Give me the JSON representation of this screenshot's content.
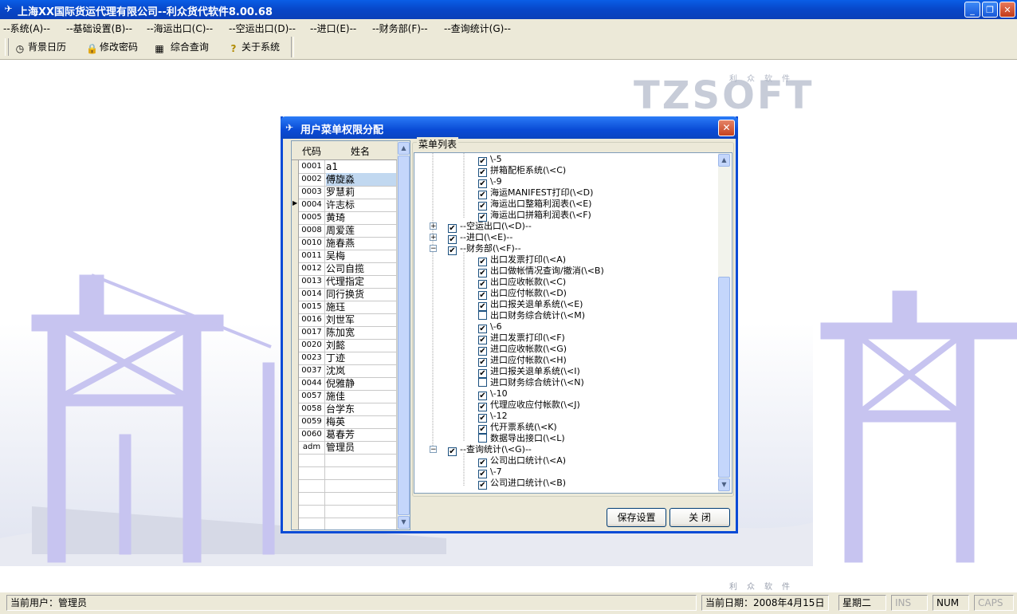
{
  "window": {
    "title": "上海XX国际货运代理有限公司--利众货代软件8.00.68",
    "minimize_glyph": "_",
    "restore_glyph": "❐",
    "close_glyph": "✕"
  },
  "menu": [
    "--系统(A)--",
    "--基础设置(B)--",
    "--海运出口(C)--",
    "--空运出口(D)--",
    "--进口(E)--",
    "--财务部(F)--",
    "--查询统计(G)--"
  ],
  "toolbar": [
    {
      "label": "背景日历",
      "icon": "calendar-clock-icon",
      "glyph": "◷"
    },
    {
      "label": "修改密码",
      "icon": "lock-icon",
      "glyph": "🔒"
    },
    {
      "label": "综合查询",
      "icon": "grid-icon",
      "glyph": "▦"
    },
    {
      "label": "关于系统",
      "icon": "help-icon",
      "glyph": "?"
    }
  ],
  "background": {
    "logo_text": "TZSOFT",
    "logo_sub": "利众软件",
    "bottom_sub": "利众软件"
  },
  "dialog": {
    "title": "用户菜单权限分配",
    "close_glyph": "✕",
    "group_label": "菜单列表",
    "grid_headers": {
      "code": "代码",
      "name": "姓名"
    },
    "users": [
      {
        "code": "0001",
        "name": "a1"
      },
      {
        "code": "0002",
        "name": "傅旋淼"
      },
      {
        "code": "0003",
        "name": "罗慧莉"
      },
      {
        "code": "0004",
        "name": "许志标"
      },
      {
        "code": "0005",
        "name": "黄琦"
      },
      {
        "code": "0008",
        "name": "周爱莲"
      },
      {
        "code": "0010",
        "name": "施春燕"
      },
      {
        "code": "0011",
        "name": "吴梅"
      },
      {
        "code": "0012",
        "name": "公司自揽"
      },
      {
        "code": "0013",
        "name": "代理指定"
      },
      {
        "code": "0014",
        "name": "同行换货"
      },
      {
        "code": "0015",
        "name": "施珏"
      },
      {
        "code": "0016",
        "name": "刘世军"
      },
      {
        "code": "0017",
        "name": "陈加宽"
      },
      {
        "code": "0020",
        "name": "刘懿"
      },
      {
        "code": "0023",
        "name": "丁迹"
      },
      {
        "code": "0037",
        "name": "沈岚"
      },
      {
        "code": "0044",
        "name": "倪雅静"
      },
      {
        "code": "0057",
        "name": "施佳"
      },
      {
        "code": "0058",
        "name": "台学东"
      },
      {
        "code": "0059",
        "name": "梅英"
      },
      {
        "code": "0060",
        "name": "葛春芳"
      },
      {
        "code": "adm",
        "name": "管理员"
      }
    ],
    "selected_user_index": 1,
    "tree": [
      {
        "label": "\\-5",
        "checked": true,
        "level": 2
      },
      {
        "label": "拼箱配柜系统(\\<C)",
        "checked": true,
        "level": 2
      },
      {
        "label": "\\-9",
        "checked": true,
        "level": 2
      },
      {
        "label": "海运MANIFEST打印(\\<D)",
        "checked": true,
        "level": 2
      },
      {
        "label": "海运出口整箱利润表(\\<E)",
        "checked": true,
        "level": 2
      },
      {
        "label": "海运出口拼箱利润表(\\<F)",
        "checked": true,
        "level": 2
      },
      {
        "label": "--空运出口(\\<D)--",
        "checked": true,
        "level": 1,
        "expander": "+"
      },
      {
        "label": "--进口(\\<E)--",
        "checked": true,
        "level": 1,
        "expander": "+"
      },
      {
        "label": "--财务部(\\<F)--",
        "checked": true,
        "level": 1,
        "expander": "-"
      },
      {
        "label": "出口发票打印(\\<A)",
        "checked": true,
        "level": 2
      },
      {
        "label": "出口做帐情况查询/撤消(\\<B)",
        "checked": true,
        "level": 2
      },
      {
        "label": "出口应收帐款(\\<C)",
        "checked": true,
        "level": 2
      },
      {
        "label": "出口应付帐款(\\<D)",
        "checked": true,
        "level": 2
      },
      {
        "label": "出口报关退单系统(\\<E)",
        "checked": true,
        "level": 2
      },
      {
        "label": "出口财务综合统计(\\<M)",
        "checked": false,
        "level": 2
      },
      {
        "label": "\\-6",
        "checked": true,
        "level": 2
      },
      {
        "label": "进口发票打印(\\<F)",
        "checked": true,
        "level": 2
      },
      {
        "label": "进口应收帐款(\\<G)",
        "checked": true,
        "level": 2
      },
      {
        "label": "进口应付帐款(\\<H)",
        "checked": true,
        "level": 2
      },
      {
        "label": "进口报关退单系统(\\<I)",
        "checked": true,
        "level": 2
      },
      {
        "label": "进口财务综合统计(\\<N)",
        "checked": false,
        "level": 2
      },
      {
        "label": "\\-10",
        "checked": true,
        "level": 2
      },
      {
        "label": "代理应收应付帐款(\\<J)",
        "checked": true,
        "level": 2
      },
      {
        "label": "\\-12",
        "checked": true,
        "level": 2
      },
      {
        "label": "代开票系统(\\<K)",
        "checked": true,
        "level": 2
      },
      {
        "label": "数据导出接口(\\<L)",
        "checked": false,
        "level": 2
      },
      {
        "label": "--查询统计(\\<G)--",
        "checked": true,
        "level": 1,
        "expander": "-"
      },
      {
        "label": "公司出口统计(\\<A)",
        "checked": true,
        "level": 2
      },
      {
        "label": "\\-7",
        "checked": true,
        "level": 2
      },
      {
        "label": "公司进口统计(\\<B)",
        "checked": true,
        "level": 2
      }
    ],
    "buttons": {
      "save": "保存设置",
      "close": "关 闭"
    }
  },
  "statusbar": {
    "current_user_label": "当前用户：管理员",
    "current_date_label": "当前日期：2008年4月15日",
    "weekday": "星期二",
    "ins": "INS",
    "num": "NUM",
    "caps": "CAPS"
  },
  "colors": {
    "titlebar": "#0746c8",
    "chrome": "#ece9d8",
    "selected_row": "#c1d8f0",
    "crane_tint": "#b9b6ec"
  }
}
